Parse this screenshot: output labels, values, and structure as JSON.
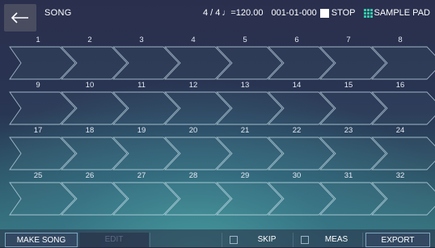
{
  "header": {
    "title": "SONG",
    "time_signature": "4 / 4",
    "tempo": "♩=120.00",
    "location": "001-01-000",
    "transport_state": "STOP",
    "pad_mode_label": "SAMPLE PAD"
  },
  "icons": {
    "back": "back-arrow-icon",
    "stop": "stop-square-icon",
    "pad": "pad-grid-icon"
  },
  "colors": {
    "pad_icon": "#35c8a8",
    "accent_border": "#7fa6c0",
    "disabled_text": "#5d6a80"
  },
  "slots": [
    {
      "number": "1"
    },
    {
      "number": "2"
    },
    {
      "number": "3"
    },
    {
      "number": "4"
    },
    {
      "number": "5"
    },
    {
      "number": "6"
    },
    {
      "number": "7"
    },
    {
      "number": "8"
    },
    {
      "number": "9"
    },
    {
      "number": "10"
    },
    {
      "number": "11"
    },
    {
      "number": "12"
    },
    {
      "number": "13"
    },
    {
      "number": "14"
    },
    {
      "number": "15"
    },
    {
      "number": "16"
    },
    {
      "number": "17"
    },
    {
      "number": "18"
    },
    {
      "number": "19"
    },
    {
      "number": "20"
    },
    {
      "number": "21"
    },
    {
      "number": "22"
    },
    {
      "number": "23"
    },
    {
      "number": "24"
    },
    {
      "number": "25"
    },
    {
      "number": "26"
    },
    {
      "number": "27"
    },
    {
      "number": "28"
    },
    {
      "number": "29"
    },
    {
      "number": "30"
    },
    {
      "number": "31"
    },
    {
      "number": "32"
    }
  ],
  "toolbar": {
    "make_song_label": "MAKE SONG",
    "edit_label": "EDIT",
    "skip_label": "SKIP",
    "skip_checked": false,
    "meas_label": "MEAS",
    "meas_checked": false,
    "export_label": "EXPORT"
  }
}
